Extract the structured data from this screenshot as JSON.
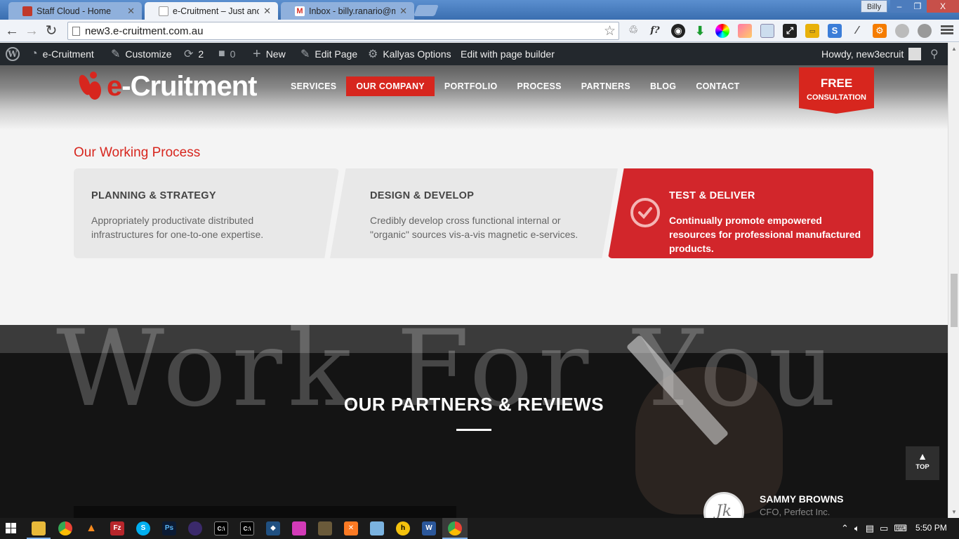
{
  "browser": {
    "tabs": [
      {
        "label": "Staff Cloud - Home",
        "active": false,
        "color": "#c0392b"
      },
      {
        "label": "e-Cruitment – Just anothe",
        "active": true,
        "color": "#6b86b8"
      },
      {
        "label": "Inbox - billy.ranario@mus",
        "active": false,
        "color": "#d93025"
      }
    ],
    "user": "Billy",
    "window_controls": {
      "minimize": "–",
      "maximize": "❐",
      "close": "X"
    },
    "url": "new3.e-cruitment.com.au",
    "nav": {
      "back": "←",
      "forward": "→",
      "reload": "↻"
    }
  },
  "adminbar": {
    "site_name": "e-Cruitment",
    "customize": "Customize",
    "updates_count": "2",
    "comments_count": "0",
    "new": "New",
    "edit_page": "Edit Page",
    "theme_options": "Kallyas Options",
    "page_builder": "Edit with page builder",
    "howdy": "Howdy, new3ecruit"
  },
  "site": {
    "logo_e": "e",
    "logo_rest": "-Cruitment",
    "nav": [
      "SERVICES",
      "OUR COMPANY",
      "PORTFOLIO",
      "PROCESS",
      "PARTNERS",
      "BLOG",
      "CONTACT"
    ],
    "active_nav": "OUR COMPANY",
    "cta_line1": "FREE",
    "cta_line2": "CONSULTATION",
    "accent": "#d7261e"
  },
  "process": {
    "title": "Our Working Process",
    "steps": [
      {
        "title": "PLANNING & STRATEGY",
        "desc": "Appropriately productivate distributed infrastructures for one-to-one expertise."
      },
      {
        "title": "DESIGN & DEVELOP",
        "desc": "Credibly develop cross functional internal or \"organic\" sources vis-a-vis magnetic e-services."
      },
      {
        "title": "TEST & DELIVER",
        "desc": "Continually promote empowered resources for professional manufactured products.",
        "highlighted": true
      }
    ]
  },
  "partners": {
    "background_word": "Work For You",
    "title": "OUR PARTNERS & REVIEWS",
    "back_to_top": "TOP",
    "reviewer_name": "SAMMY BROWNS",
    "reviewer_role": "CFO, Perfect Inc.",
    "reviewer_initials": "Jk"
  },
  "taskbar": {
    "time": "5:50 PM",
    "apps": [
      "file-explorer-icon",
      "chrome-icon",
      "vlc-icon",
      "filezilla-icon",
      "skype-icon",
      "photoshop-icon",
      "eclipse-icon",
      "cmd-icon",
      "cmd-icon",
      "sourcetree-icon",
      "app-icon",
      "notepad-icon",
      "xampp-icon",
      "snipping-icon",
      "hamachi-icon",
      "word-icon",
      "chrome-icon"
    ]
  }
}
